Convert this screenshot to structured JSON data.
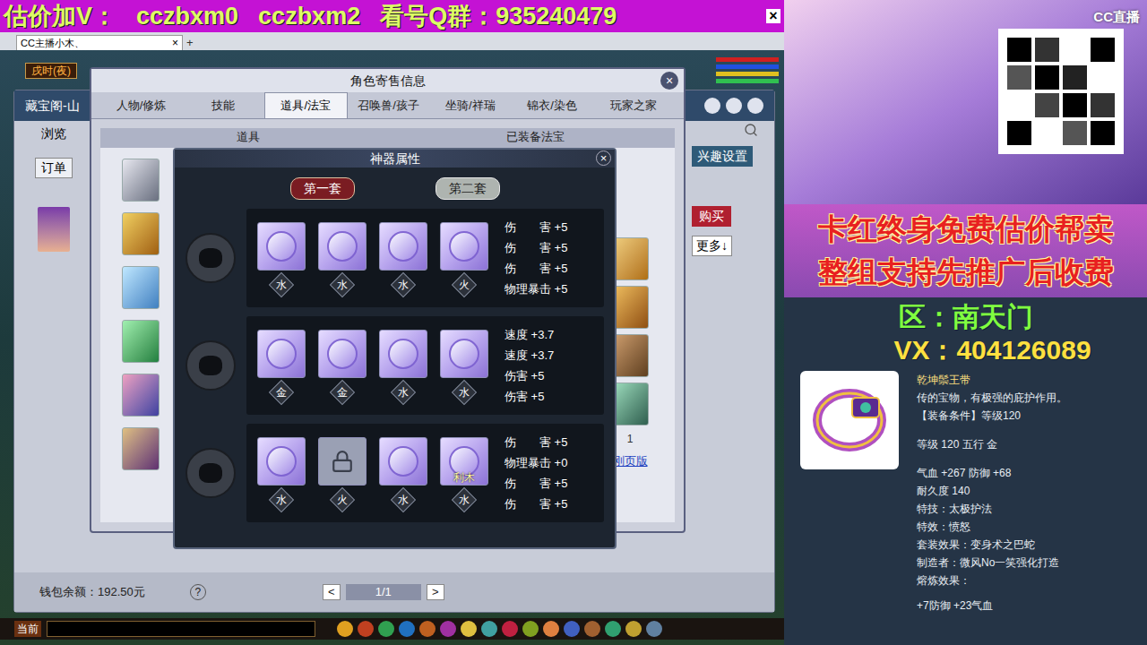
{
  "banner": {
    "label": "估价加V：",
    "contacts": [
      "cczbxm0",
      "cczbxm2"
    ],
    "group": "看号Q群：935240479",
    "close": "×"
  },
  "browser_tab": {
    "title": "CC主播小木、",
    "close": "×",
    "add": "+"
  },
  "game": {
    "clock": "戌时(夜)",
    "chat_channel": "当前"
  },
  "market_window": {
    "title": "藏宝阁-山",
    "browse": "浏览",
    "orders": "订单",
    "interest": "兴趣设置",
    "buy": "购买",
    "more": "更多↓",
    "wallet": "钱包余额：192.50元",
    "help": "?",
    "prev": "<",
    "page": "1/1",
    "next": ">"
  },
  "trade_window": {
    "title": "角色寄售信息",
    "close": "×",
    "tabs": [
      {
        "label": "人物/修炼",
        "selected": false
      },
      {
        "label": "技能",
        "selected": false
      },
      {
        "label": "道具/法宝",
        "selected": true
      },
      {
        "label": "召唤兽/孩子",
        "selected": false
      },
      {
        "label": "坐骑/祥瑞",
        "selected": false
      },
      {
        "label": "锦衣/染色",
        "selected": false
      },
      {
        "label": "玩家之家",
        "selected": false
      }
    ],
    "headers": [
      "道具",
      "已装备法宝"
    ],
    "list_count": "1",
    "link": "刚页版"
  },
  "artifact": {
    "title": "神器属性",
    "close": "×",
    "sets": [
      {
        "label": "第一套",
        "selected": true
      },
      {
        "label": "第二套",
        "selected": false
      }
    ],
    "rows": [
      {
        "gems": [
          {
            "element": "水",
            "locked": false,
            "tag": ""
          },
          {
            "element": "水",
            "locked": false,
            "tag": ""
          },
          {
            "element": "水",
            "locked": false,
            "tag": ""
          },
          {
            "element": "火",
            "locked": false,
            "tag": ""
          }
        ],
        "attributes": [
          "伤　　害 +5",
          "伤　　害 +5",
          "伤　　害 +5",
          "物理暴击 +5"
        ]
      },
      {
        "gems": [
          {
            "element": "金",
            "locked": false,
            "tag": ""
          },
          {
            "element": "金",
            "locked": false,
            "tag": ""
          },
          {
            "element": "水",
            "locked": false,
            "tag": ""
          },
          {
            "element": "水",
            "locked": false,
            "tag": ""
          }
        ],
        "attributes": [
          "速度 +3.7",
          "速度 +3.7",
          "伤害 +5",
          "伤害 +5"
        ]
      },
      {
        "gems": [
          {
            "element": "水",
            "locked": false,
            "tag": ""
          },
          {
            "element": "火",
            "locked": true,
            "tag": ""
          },
          {
            "element": "水",
            "locked": false,
            "tag": ""
          },
          {
            "element": "水",
            "locked": false,
            "tag": "利木"
          }
        ],
        "attributes": [
          "伤　　害 +5",
          "物理暴击 +0",
          "伤　　害 +5",
          "伤　　害 +5"
        ]
      }
    ]
  },
  "stream": {
    "logo": "CC直播",
    "promo": [
      "卡红终身免费估价帮卖",
      "整组支持先推广后收费"
    ],
    "server": "区：南天门",
    "vx": "VX：404126089",
    "item": {
      "name": "乾坤鬃王带",
      "desc": "传的宝物，有极强的庇护作用。",
      "requirement": "【装备条件】等级120",
      "level": "等级 120 五行 金",
      "stats": "气血 +267 防御 +68",
      "durability": "耐久度 140",
      "skill": "特技：太极护法",
      "effect": "特效：愤怒",
      "set": "套装效果：变身术之巴蛇",
      "maker": "制造者：微风No一笑强化打造",
      "smelt": "熔炼效果：",
      "smelt_stats": "+7防御 +23气血"
    }
  }
}
